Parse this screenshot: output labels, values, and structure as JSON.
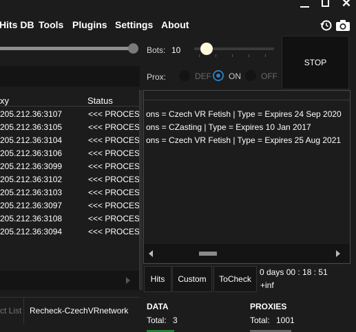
{
  "window": {
    "minimize": "—",
    "maximize": "☐",
    "close": "✕"
  },
  "menu": [
    "Hits DB",
    "Tools",
    "Plugins",
    "Settings",
    "About"
  ],
  "icons": {
    "history": "history-icon",
    "screenshot": "camera-icon"
  },
  "bots": {
    "label": "Bots:",
    "value": "10",
    "fraction": 0.08
  },
  "stop_label": "STOP",
  "proxy_mode": {
    "label": "Prox:",
    "options": [
      "DEF",
      "ON",
      "OFF"
    ],
    "selected": "ON"
  },
  "grid": {
    "columns": [
      "xy",
      "Status"
    ],
    "rows": [
      {
        "proxy": "205.212.36:3107",
        "status": "<<< PROCESSING"
      },
      {
        "proxy": "205.212.36:3105",
        "status": "<<< PROCESSING"
      },
      {
        "proxy": "205.212.36:3104",
        "status": "<<< PROCESSING"
      },
      {
        "proxy": "205.212.36:3106",
        "status": "<<< PROCESSING"
      },
      {
        "proxy": "205.212.36:3099",
        "status": "<<< PROCESSING"
      },
      {
        "proxy": "205.212.36:3102",
        "status": "<<< PROCESSING"
      },
      {
        "proxy": "205.212.36:3103",
        "status": "<<< PROCESSING"
      },
      {
        "proxy": "205.212.36:3097",
        "status": "<<< PROCESSING"
      },
      {
        "proxy": "205.212.36:3108",
        "status": "<<< PROCESSING"
      },
      {
        "proxy": "205.212.36:3094",
        "status": "<<< PROCESSING"
      }
    ]
  },
  "hits": [
    "ons = Czech VR Fetish | Type = Expires 24 Sep 2020",
    "ons = CZasting | Type = Expires 10 Jan 2017",
    "ons = Czech VR Fetish | Type = Expires 25 Aug 2021"
  ],
  "buttons": {
    "hits": "Hits",
    "custom": "Custom",
    "tocheck": "ToCheck"
  },
  "timer": {
    "elapsed": "0  days  00 : 18 : 51",
    "remaining": "+inf"
  },
  "tabs": {
    "left": "ct List",
    "right": "Recheck-CzechVRnetwork"
  },
  "stats": {
    "data_title": "DATA",
    "total_label": "Total:",
    "total": "3",
    "proxies_title": "PROXIES",
    "proxies_total_label": "Total:",
    "proxies_total": "1001"
  },
  "colors": {
    "accent": "#2a7fb8",
    "background": "#1c1c1c",
    "hits_green": "#2ecc40"
  }
}
